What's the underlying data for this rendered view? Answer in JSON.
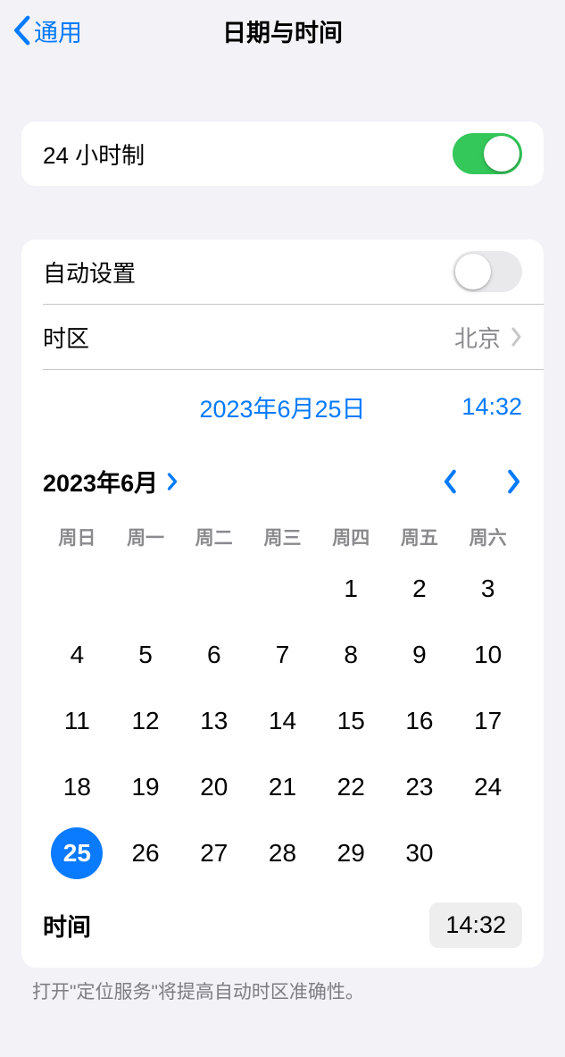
{
  "nav": {
    "back_label": "通用",
    "title": "日期与时间"
  },
  "settings": {
    "twenty_four_hour_label": "24 小时制",
    "twenty_four_hour_on": true,
    "auto_set_label": "自动设置",
    "auto_set_on": false,
    "timezone_label": "时区",
    "timezone_value": "北京"
  },
  "date_time": {
    "date_display": "2023年6月25日",
    "time_display": "14:32"
  },
  "calendar": {
    "month_title": "2023年6月",
    "weekdays": [
      "周日",
      "周一",
      "周二",
      "周三",
      "周四",
      "周五",
      "周六"
    ],
    "leading_blanks": 4,
    "days": [
      "1",
      "2",
      "3",
      "4",
      "5",
      "6",
      "7",
      "8",
      "9",
      "10",
      "11",
      "12",
      "13",
      "14",
      "15",
      "16",
      "17",
      "18",
      "19",
      "20",
      "21",
      "22",
      "23",
      "24",
      "25",
      "26",
      "27",
      "28",
      "29",
      "30"
    ],
    "selected_day": "25",
    "time_label": "时间",
    "time_value": "14:32"
  },
  "footer_note": "打开\"定位服务\"将提高自动时区准确性。"
}
